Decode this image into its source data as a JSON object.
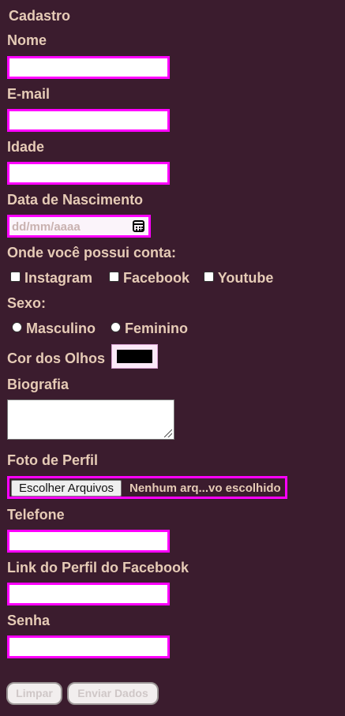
{
  "form": {
    "title": "Cadastro",
    "name_label": "Nome",
    "email_label": "E-mail",
    "age_label": "Idade",
    "birthdate_label": "Data de Nascimento",
    "birthdate_placeholder": "dd/mm/aaaa",
    "accounts_label": "Onde você possui conta:",
    "accounts": [
      "Instagram",
      "Facebook",
      "Youtube"
    ],
    "sex_label": "Sexo:",
    "sex_options": [
      "Masculino",
      "Feminino"
    ],
    "eye_color_label": "Cor dos Olhos",
    "eye_color_value": "#000000",
    "bio_label": "Biografia",
    "photo_label": "Foto de Perfil",
    "file_button_label": "Escolher Arquivos",
    "file_status": "Nenhum arq...vo escolhido",
    "phone_label": "Telefone",
    "facebook_link_label": "Link do Perfil do Facebook",
    "password_label": "Senha",
    "clear_button": "Limpar",
    "submit_button": "Enviar Dados"
  },
  "colors": {
    "background": "#3b1c2e",
    "text": "#e6cbb6",
    "field_border": "#ff00ff"
  }
}
